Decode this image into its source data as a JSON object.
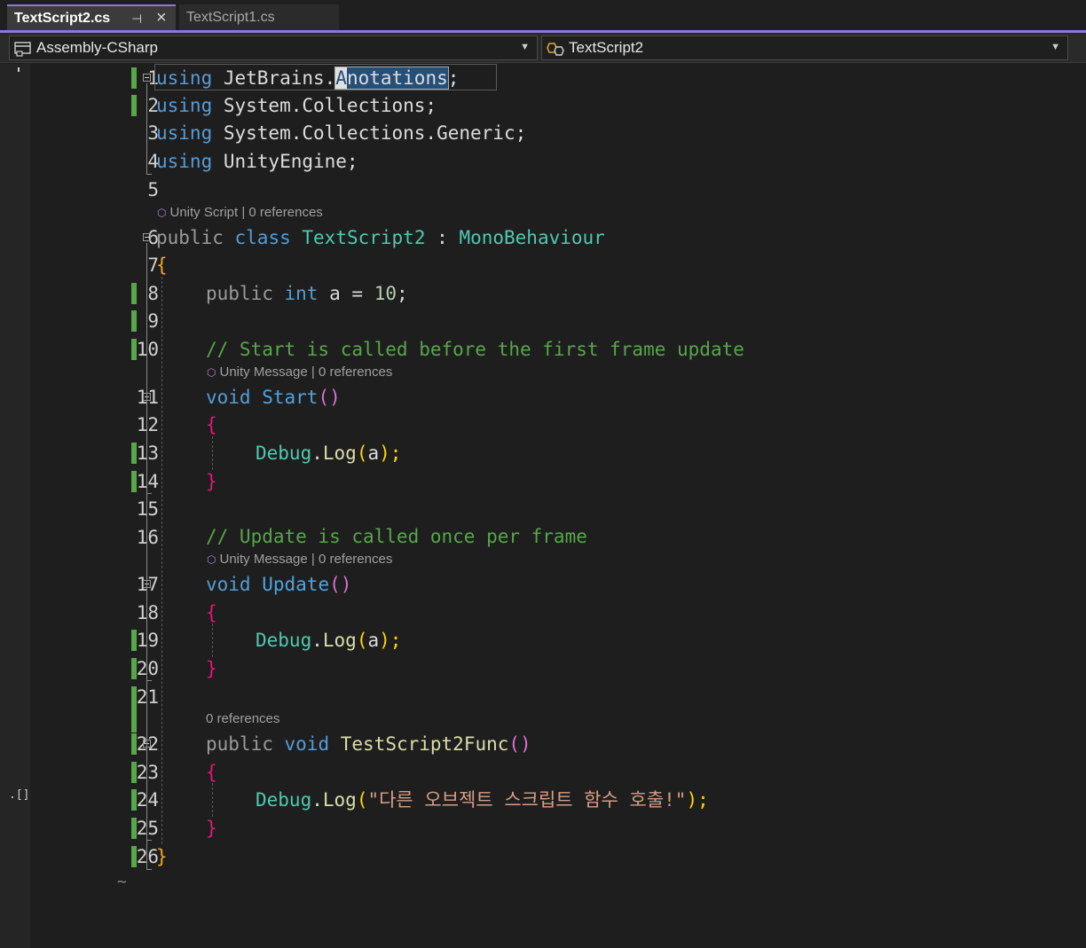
{
  "tabs": {
    "active": {
      "label": "TextScript2.cs",
      "pin_icon": "pin-icon",
      "close_icon": "close-icon"
    },
    "inactive": {
      "label": "TextScript1.cs"
    }
  },
  "navbar": {
    "project": "Assembly-CSharp",
    "type": "TextScript2"
  },
  "margin_glyphs": {
    "line6": "⬚↑",
    "line24": ".[]"
  },
  "code_lens": {
    "class": [
      "Unity Script",
      "0 references"
    ],
    "start": [
      "Unity Message",
      "0 references"
    ],
    "update": [
      "Unity Message",
      "0 references"
    ],
    "func": "0 references"
  },
  "lines": {
    "l1": {
      "num": "1",
      "kw": "using",
      "rest1": " JetBrains.",
      "sel1": "A",
      "sel2": "notations",
      "end": ";"
    },
    "l2": {
      "num": "2",
      "kw": "using",
      "rest": " System.Collections;"
    },
    "l3": {
      "num": "3",
      "kw": "using",
      "rest": " System.Collections.Generic;"
    },
    "l4": {
      "num": "4",
      "kw": "using",
      "rest": " UnityEngine;"
    },
    "l5": {
      "num": "5"
    },
    "l6": {
      "num": "6",
      "a": "public",
      "b": "class",
      "c": "TextScript2",
      "d": ":",
      "e": "MonoBehaviour"
    },
    "l7": {
      "num": "7",
      "a": "{"
    },
    "l8": {
      "num": "8",
      "a": "public",
      "b": "int",
      "c": "a",
      "d": "=",
      "e": "10",
      "f": ";"
    },
    "l9": {
      "num": "9"
    },
    "l10": {
      "num": "10",
      "a": "// Start is called before the first frame update"
    },
    "l11": {
      "num": "11",
      "a": "void",
      "b": "Start",
      "c": "()"
    },
    "l12": {
      "num": "12",
      "a": "{"
    },
    "l13": {
      "num": "13",
      "a": "Debug",
      "b": ".",
      "c": "Log",
      "d": "(",
      "e": "a",
      "f": ");"
    },
    "l14": {
      "num": "14",
      "a": "}"
    },
    "l15": {
      "num": "15"
    },
    "l16": {
      "num": "16",
      "a": "// Update is called once per frame"
    },
    "l17": {
      "num": "17",
      "a": "void",
      "b": "Update",
      "c": "()"
    },
    "l18": {
      "num": "18",
      "a": "{"
    },
    "l19": {
      "num": "19",
      "a": "Debug",
      "b": ".",
      "c": "Log",
      "d": "(",
      "e": "a",
      "f": ");"
    },
    "l20": {
      "num": "20",
      "a": "}"
    },
    "l21": {
      "num": "21"
    },
    "l22": {
      "num": "22",
      "a": "public",
      "b": "void",
      "c": "TestScript2Func",
      "d": "()"
    },
    "l23": {
      "num": "23",
      "a": "{"
    },
    "l24": {
      "num": "24",
      "a": "Debug",
      "b": ".",
      "c": "Log",
      "d": "(",
      "e": "\"다른 오브젝트 스크립트 함수 호출!\"",
      "f": ");"
    },
    "l25": {
      "num": "25",
      "a": "}"
    },
    "l26": {
      "num": "26",
      "a": "}"
    },
    "eof": "~"
  }
}
